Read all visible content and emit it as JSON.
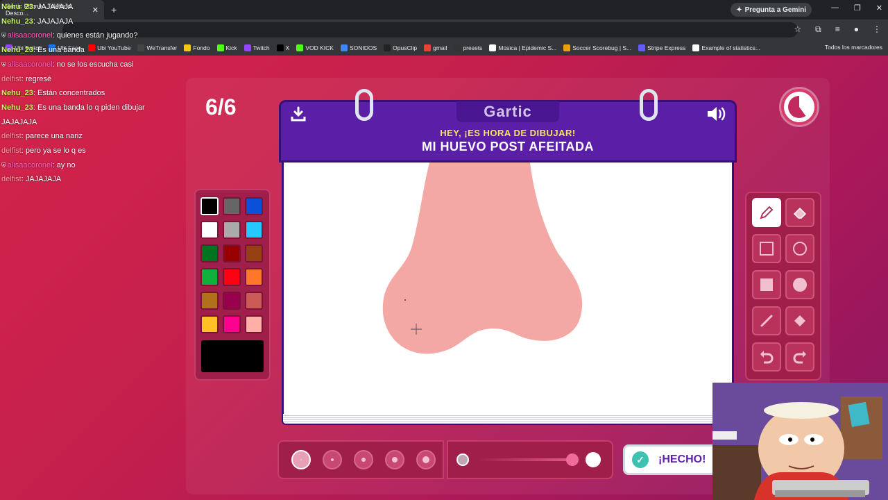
{
  "browser": {
    "tab_title": "Gartic Phone - Teléfono Desco...",
    "gemini_label": "Pregunta a Gemini",
    "bookmarks": [
      "Ubi Twitch",
      "Ubi Face",
      "Ubi YouTube",
      "WeTransfer",
      "Fondo",
      "Kick",
      "Twitch",
      "X",
      "VOD KICK",
      "SONIDOS",
      "OpusClip",
      "gmail",
      "presets",
      "Música | Epidemic S...",
      "Soccer Scorebug | S...",
      "Stripe Express",
      "Example of statistics..."
    ],
    "all_bookmarks": "Todos los marcadores"
  },
  "chat": [
    {
      "user": "Nehu_23",
      "text": "JAJAJAJA",
      "color": "#c7f55c",
      "badge": false
    },
    {
      "user": "Nehu_23",
      "text": "JAJAJAJA",
      "color": "#c7f55c",
      "badge": false
    },
    {
      "user": "alisaacoronel",
      "text": "quienes están jugando?",
      "color": "#ff5fc0",
      "badge": true
    },
    {
      "user": "Nehu_23",
      "text": "Es una banda",
      "color": "#c7f55c",
      "badge": false
    },
    {
      "user": "alisaacoronel",
      "text": "no se los escucha casi",
      "color": "#ff5fc0",
      "badge": true
    },
    {
      "user": "delfist",
      "text": "regresé",
      "color": "#ff9aa2",
      "badge": false
    },
    {
      "user": "Nehu_23",
      "text": "Están concentrados",
      "color": "#c7f55c",
      "badge": false
    },
    {
      "user": "Nehu_23",
      "text": "Es una banda lo q piden dibujar JAJAJAJA",
      "color": "#c7f55c",
      "badge": false
    },
    {
      "user": "delfist",
      "text": "parece una nariz",
      "color": "#ff9aa2",
      "badge": false
    },
    {
      "user": "delfist",
      "text": "pero ya se lo q es",
      "color": "#ff9aa2",
      "badge": false
    },
    {
      "user": "alisaacoronel",
      "text": "ay no",
      "color": "#ff5fc0",
      "badge": true
    },
    {
      "user": "delfist",
      "text": "JAJAJAJA",
      "color": "#ff9aa2",
      "badge": false
    }
  ],
  "game": {
    "round": "6/6",
    "logo": "Gartic",
    "header_hint": "HEY, ¡ES HORA DE DIBUJAR!",
    "prompt": "MI HUEVO POST AFEITADA",
    "done_label": "¡HECHO!",
    "timer_fraction_remaining": 0.6
  },
  "palette": {
    "selected": "#000000",
    "colors": [
      "#000000",
      "#666666",
      "#0a50d8",
      "#ffffff",
      "#aaaaaa",
      "#26c9ff",
      "#017420",
      "#990000",
      "#964112",
      "#11b03c",
      "#ff0013",
      "#ff7829",
      "#b0701c",
      "#99004e",
      "#cb5a57",
      "#ffc126",
      "#ff008f",
      "#feafa8"
    ]
  },
  "tools": [
    "pencil",
    "eraser",
    "rect-outline",
    "ellipse-outline",
    "rect-fill",
    "ellipse-fill",
    "line",
    "bucket",
    "undo",
    "redo"
  ],
  "brush_sizes": [
    1,
    2,
    3,
    4,
    5
  ],
  "drawing": {
    "fill": "#f4a8a6"
  }
}
